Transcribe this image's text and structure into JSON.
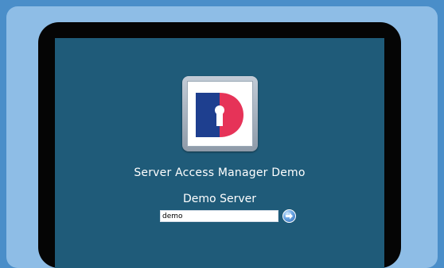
{
  "login": {
    "app_title": "Server Access Manager Demo",
    "server_name": "Demo Server",
    "username_value": "demo"
  },
  "icons": {
    "logo": "server-access-manager-logo",
    "submit": "arrow-right-icon"
  },
  "colors": {
    "background": "#4a8ec9",
    "panel": "#8ebde6",
    "screen": "#1f5b79",
    "logo_blue": "#1e3f8f",
    "logo_red": "#e63358"
  }
}
